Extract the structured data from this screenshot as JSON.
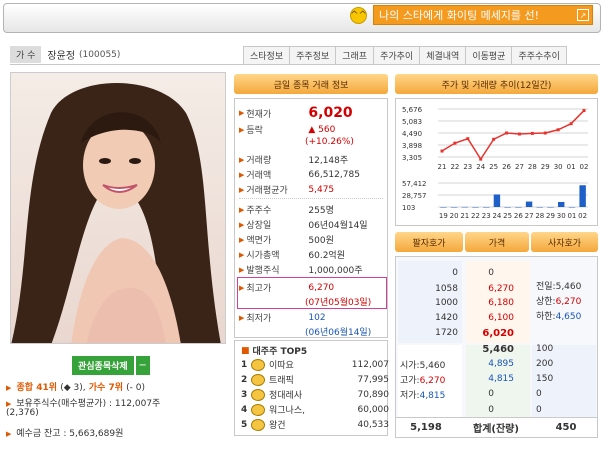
{
  "notice": {
    "text": "나의 스타에게 화이팅 메세지를 선!",
    "smile": "^^"
  },
  "artist": {
    "role": "가 수",
    "name": "장윤정",
    "id": "(100055)"
  },
  "tabs": [
    "스타정보",
    "주주정보",
    "그래프",
    "주가추이",
    "체결내역",
    "이동평균",
    "주주수추이"
  ],
  "profile": {
    "delete_label": "관심종목삭제",
    "delete_icon": "−",
    "rank_line": {
      "prefix": "종합",
      "rank": "41위",
      "change1": "(◆ 3),",
      "cat": "가수",
      "rank2": "7위",
      "change2": "(- 0)"
    },
    "holdings": "보유주식수(매수평균가) : 112,007주",
    "holdings2": "(2,376)",
    "deposit": "예수금 잔고 : 5,663,689원"
  },
  "trade": {
    "title": "금일 종목 거래 정보",
    "current_label": "현재가",
    "current": "6,020",
    "change_label": "등락",
    "change": "▲ 560",
    "change_pct": "(+10.26%)",
    "volume_label": "거래량",
    "volume": "12,148주",
    "amount_label": "거래액",
    "amount": "66,512,785",
    "avg_label": "거래평균가",
    "avg": "5,475",
    "holders_label": "주주수",
    "holders": "255명",
    "listed_label": "상장일",
    "listed": "06년04월14일",
    "face_label": "액면가",
    "face": "500원",
    "cap_label": "시가총액",
    "cap": "60.2억원",
    "shares_label": "발행주식",
    "shares": "1,000,000주",
    "high_label": "최고가",
    "high": "6,270",
    "high_date": "(07년05월03일)",
    "low_label": "최저가",
    "low": "102",
    "low_date": "(06년06월14일)"
  },
  "top5": {
    "title": "대주주 TOP5",
    "rows": [
      {
        "rank": "1",
        "name": "이따요",
        "value": "112,007"
      },
      {
        "rank": "2",
        "name": "트래픽",
        "value": "77,995"
      },
      {
        "rank": "3",
        "name": "정대레사",
        "value": "70,890"
      },
      {
        "rank": "4",
        "name": "워그나스,",
        "value": "60,000"
      },
      {
        "rank": "5",
        "name": "왕건",
        "value": "40,533"
      }
    ]
  },
  "chart_title": "주가 및 거래량 추이(12일간)",
  "chart_data": [
    {
      "type": "line",
      "x": [
        "21",
        "22",
        "23",
        "24",
        "25",
        "26",
        "27",
        "28",
        "29",
        "30",
        "01",
        "02"
      ],
      "values": [
        3600,
        3990,
        4210,
        3200,
        4180,
        4490,
        4440,
        4470,
        4490,
        4650,
        4950,
        5600
      ],
      "yticks": [
        "5,676",
        "5,083",
        "4,490",
        "3,898",
        "3,305"
      ],
      "ylim": [
        3305,
        5676
      ],
      "color": "#e8332e"
    },
    {
      "type": "bar",
      "x": [
        "19",
        "20",
        "21",
        "22",
        "23",
        "24",
        "25",
        "26",
        "27",
        "28",
        "29",
        "30",
        "01",
        "02"
      ],
      "values": [
        0,
        0,
        200,
        0,
        0,
        30000,
        0,
        0,
        13000,
        0,
        0,
        12000,
        0,
        52000
      ],
      "yticks": [
        "57,412",
        "28,757",
        "103"
      ],
      "ylim": [
        0,
        57412
      ],
      "color": "#1e5fc8"
    }
  ],
  "orderbook": {
    "headers": [
      "팔자호가",
      "가격",
      "사자호가"
    ],
    "sell_qty": [
      "0",
      "1058",
      "1000",
      "1420",
      "1720"
    ],
    "sell_price": [
      "0",
      "6,270",
      "6,180",
      "6,100",
      "6,020"
    ],
    "buy_price": [
      "5,460",
      "4,895",
      "4,815",
      "0",
      "0"
    ],
    "buy_qty": [
      "100",
      "200",
      "150",
      "0",
      "0"
    ],
    "prev_label": "전일:",
    "prev": "5,460",
    "upper_label": "상한:",
    "upper": "6,270",
    "lower_label": "하한:",
    "lower": "4,650",
    "open_label": "시가:",
    "open": "5,460",
    "hi_label": "고가:",
    "hi": "6,270",
    "lo_label": "저가:",
    "lo": "4,815",
    "total_sell": "5,198",
    "total_label": "합계(잔량)",
    "total_buy": "450"
  }
}
